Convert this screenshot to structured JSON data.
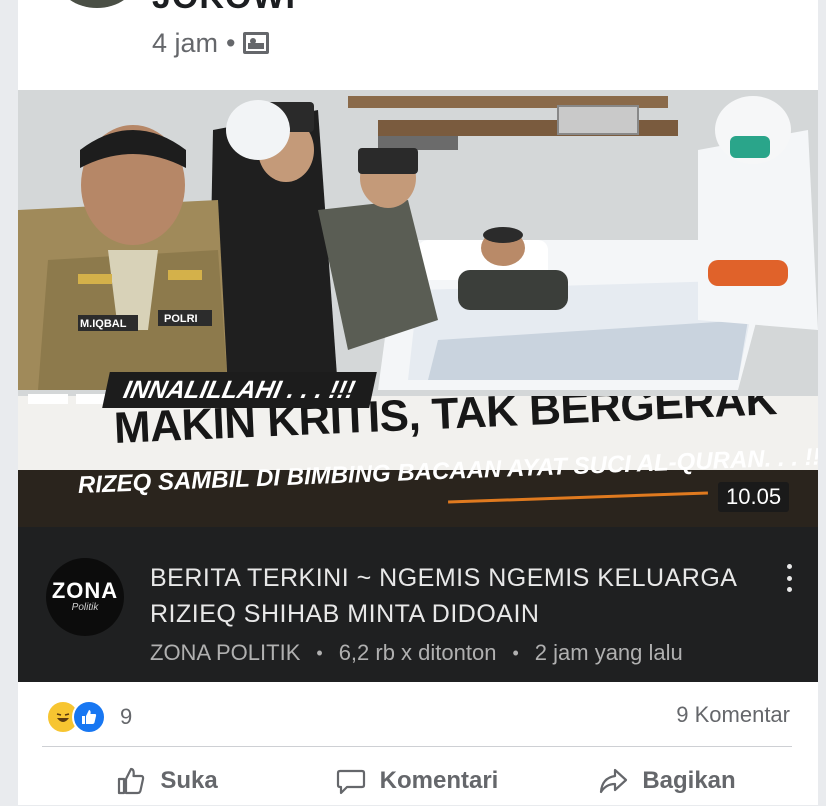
{
  "post": {
    "author_partial": "JOKOWI",
    "time": "4 jam",
    "separator": "•"
  },
  "thumbnail": {
    "banner_small": "INNALILLAHI . . . !!!",
    "headline_1": "MAKIN KRITIS, TAK BERGERAK",
    "headline_2": "RIZEQ SAMBIL DI BIMBING BACAAN AYAT SUCI AL-QURAN. . . !!?",
    "badge_nameplate": "M.IQBAL",
    "badge_polri": "POLRI",
    "duration": "10.05"
  },
  "video": {
    "channel_logo": "ZONA",
    "channel_logo_sub": "Politik",
    "title_line1": "BERITA TERKINI ~ NGEMIS NGEMIS KELUARGA",
    "title_line2": "RIZIEQ SHIHAB MINTA DIDOAIN",
    "channel": "ZONA POLITIK",
    "views": "6,2 rb x ditonton",
    "age": "2 jam yang lalu",
    "dot": "•"
  },
  "engagement": {
    "reaction_count": "9",
    "comments": "9 Komentar"
  },
  "actions": {
    "like": "Suka",
    "comment": "Komentari",
    "share": "Bagikan"
  },
  "icons": {
    "photo": "photo-icon",
    "haha": "haha-reaction-icon",
    "like_reaction": "like-reaction-icon",
    "like_action": "thumbs-up-icon",
    "comment_action": "speech-bubble-icon",
    "share_action": "share-arrow-icon",
    "more": "kebab-menu-icon"
  },
  "colors": {
    "accent_blue": "#1877f2",
    "haha_yellow": "#f7c531",
    "banner_orange": "#e07a1f"
  }
}
